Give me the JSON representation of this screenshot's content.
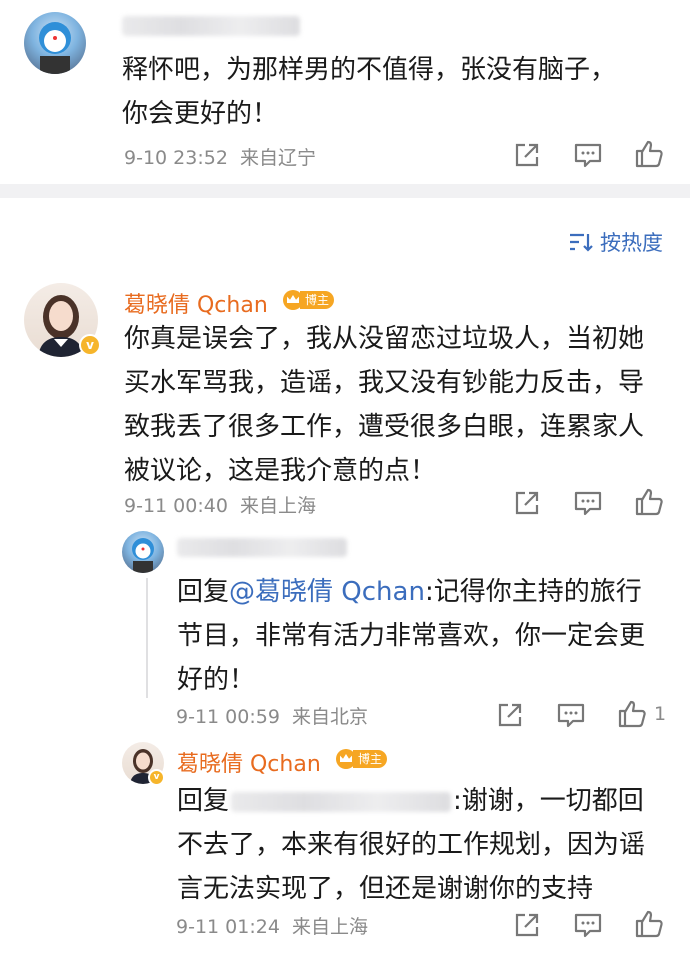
{
  "comment_1": {
    "text_line1": "释怀吧，为那样男的不值得，张没有脑子，",
    "text_line2": "你会更好的！",
    "time": "9-10 23:52",
    "location": "来自辽宁"
  },
  "sort": {
    "label": "按热度",
    "icon": "sort-icon"
  },
  "comment_2": {
    "author": "葛晓倩 Qchan",
    "badge": "博主",
    "text_lines": [
      "你真是误会了，我从没留恋过垃圾人，当初她",
      "买水军骂我，造谣，我又没有钞能力反击，导",
      "致我丢了很多工作，遭受很多白眼，连累家人",
      "被议论，这是我介意的点！"
    ],
    "time": "9-11 00:40",
    "location": "来自上海"
  },
  "reply_1": {
    "reply_prefix": "回复",
    "mention": "@葛晓倩 Qchan",
    "text_first": ":记得你主持的旅行",
    "text_lines": [
      "节目，非常有活力非常喜欢，你一定会更",
      "好的！"
    ],
    "time": "9-11 00:59",
    "location": "来自北京",
    "like_count": "1"
  },
  "reply_2": {
    "author": "葛晓倩 Qchan",
    "badge": "博主",
    "reply_prefix": "回复",
    "text_first": ":谢谢，一切都回",
    "text_lines": [
      "不去了，本来有很好的工作规划，因为谣",
      "言无法实现了，但还是谢谢你的支持"
    ],
    "time": "9-11 01:24",
    "location": "来自上海"
  },
  "colors": {
    "accent": "#e86b1f",
    "link": "#3b6dbd",
    "badge": "#f6a623",
    "meta": "#8a8a8a"
  }
}
